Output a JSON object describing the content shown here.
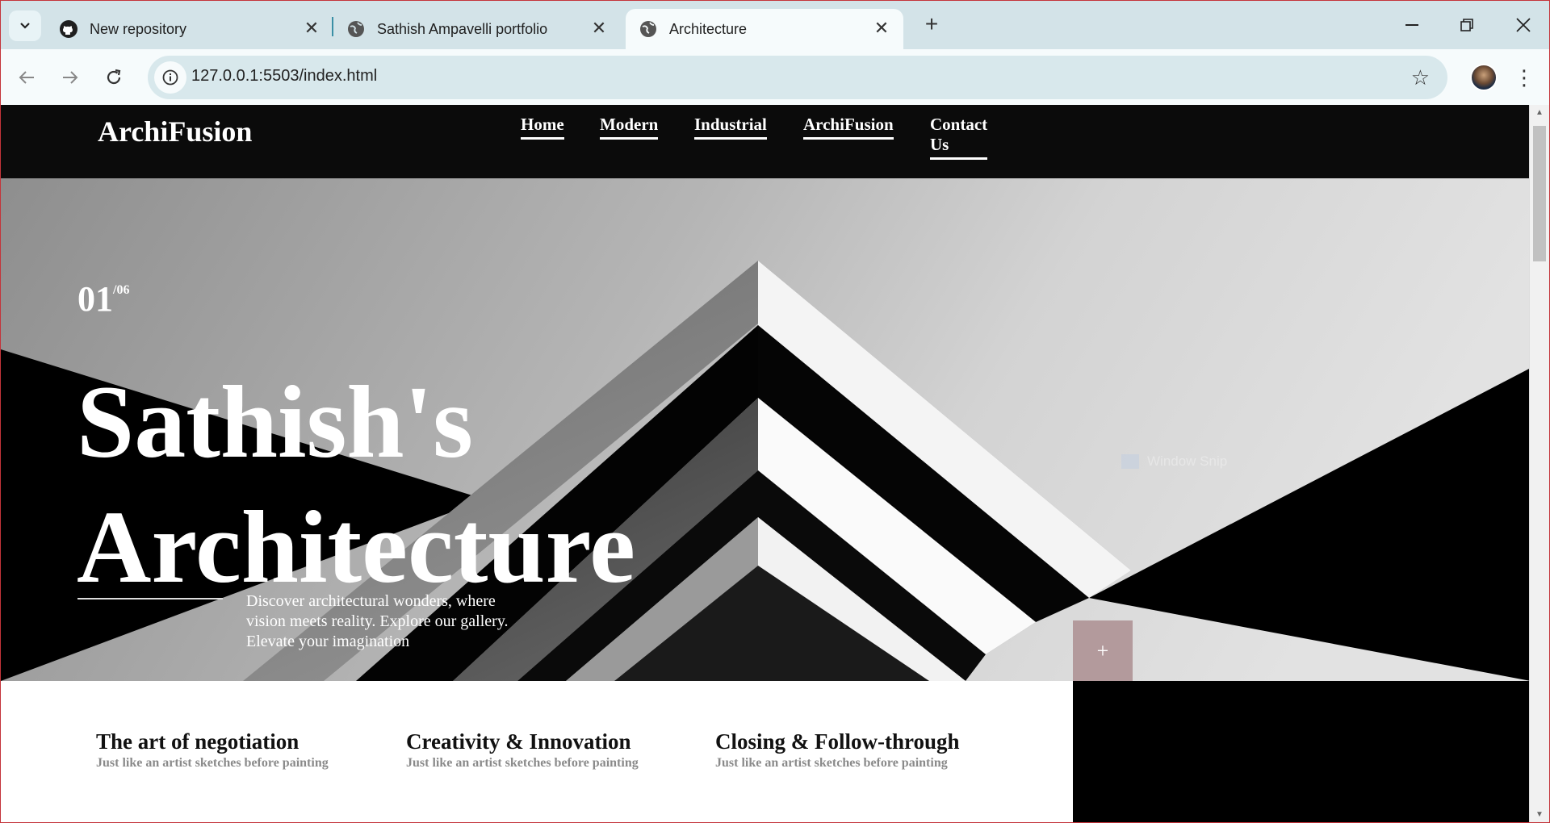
{
  "browser": {
    "tabs": [
      {
        "title": "New repository",
        "icon": "github-icon"
      },
      {
        "title": "Sathish Ampavelli portfolio",
        "icon": "globe-icon"
      },
      {
        "title": "Architecture",
        "icon": "globe-icon",
        "active": true
      }
    ],
    "url": "127.0.0.1:5503/index.html"
  },
  "site": {
    "logo": "ArchiFusion",
    "nav": [
      "Home",
      "Modern",
      "Industrial",
      "ArchiFusion",
      "Contact Us"
    ],
    "hero": {
      "counter_current": "01",
      "counter_total": "/06",
      "headline_line1": "Sathish's",
      "headline_line2": "Architecture",
      "description": "Discover architectural wonders, where vision meets reality. Explore our gallery. Elevate your imagination",
      "plus_label": "+"
    },
    "overlay_text": "Window Snip",
    "features": [
      {
        "title": "The art of negotiation",
        "subtitle": "Just like an artist sketches before painting"
      },
      {
        "title": "Creativity & Innovation",
        "subtitle": "Just like an artist sketches before painting"
      },
      {
        "title": "Closing & Follow-through",
        "subtitle": "Just like an artist sketches before painting"
      }
    ]
  },
  "colors": {
    "header_bg": "#0b0b0b",
    "accent_button": "#b39a9c",
    "chrome_bg": "#d3e3e8"
  }
}
